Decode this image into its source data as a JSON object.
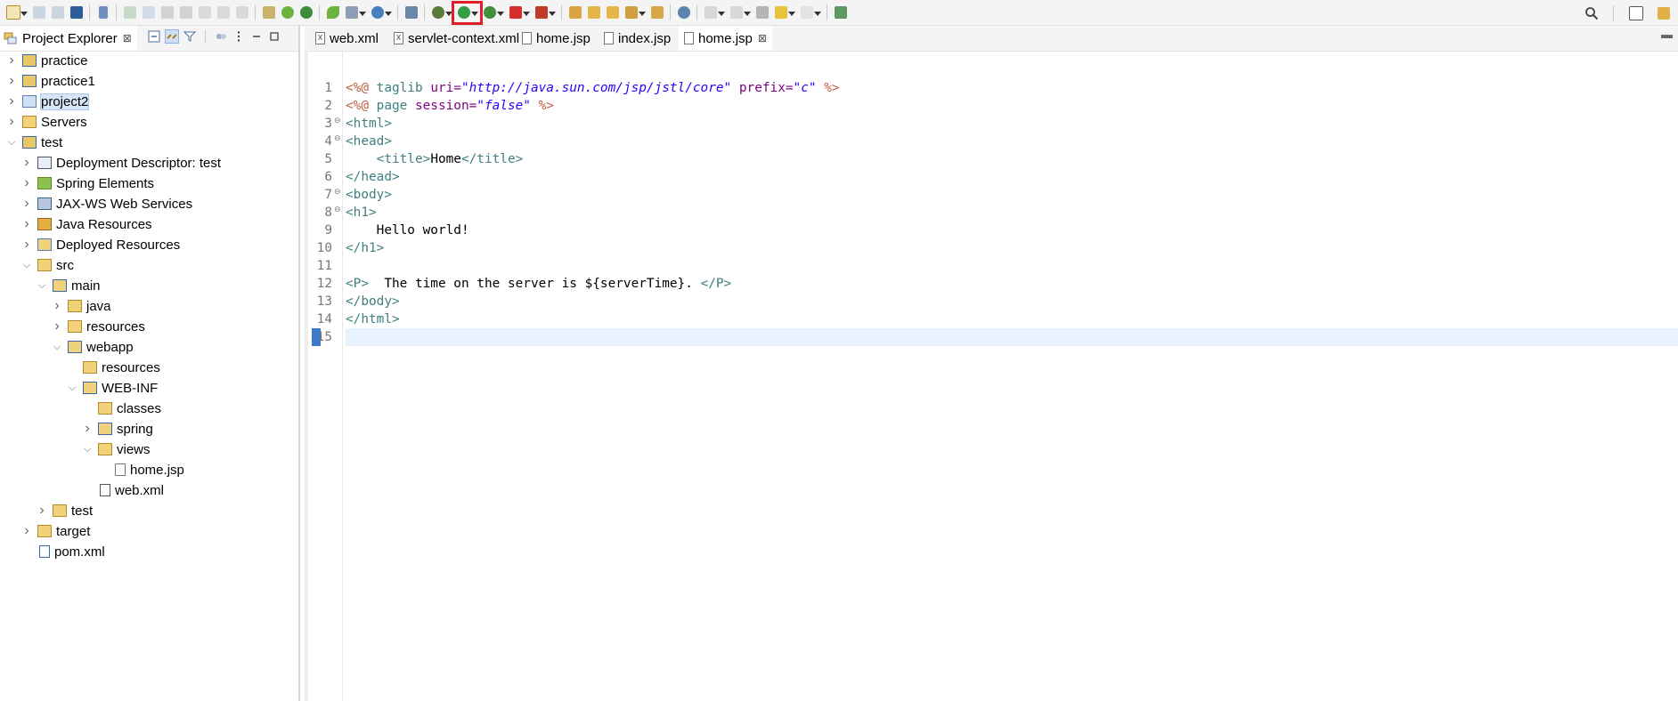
{
  "toolbar": {
    "run_button_highlight_color": "#e21f26"
  },
  "explorer": {
    "title": "Project Explorer",
    "close_glyph": "⊠",
    "tree": [
      {
        "label": "practice",
        "icon": "maven-project-icon",
        "expanded": false
      },
      {
        "label": "practice1",
        "icon": "maven-project-icon",
        "expanded": false
      },
      {
        "label": "project2",
        "icon": "project-icon",
        "expanded": false,
        "selected": true
      },
      {
        "label": "Servers",
        "icon": "folder-icon",
        "expanded": false
      },
      {
        "label": "test",
        "icon": "maven-project-icon",
        "expanded": true
      },
      {
        "label": "Deployment Descriptor: test",
        "icon": "deployment-descriptor-icon",
        "expanded": false
      },
      {
        "label": "Spring Elements",
        "icon": "spring-leaf-icon",
        "expanded": false
      },
      {
        "label": "JAX-WS Web Services",
        "icon": "web-services-icon",
        "expanded": false
      },
      {
        "label": "Java Resources",
        "icon": "java-resources-icon",
        "expanded": false
      },
      {
        "label": "Deployed Resources",
        "icon": "deployed-resources-icon",
        "expanded": false
      },
      {
        "label": "src",
        "icon": "folder-icon",
        "expanded": true
      },
      {
        "label": "main",
        "icon": "source-folder-icon",
        "expanded": true
      },
      {
        "label": "java",
        "icon": "folder-icon",
        "expanded": false
      },
      {
        "label": "resources",
        "icon": "folder-icon",
        "expanded": false
      },
      {
        "label": "webapp",
        "icon": "source-folder-icon",
        "expanded": true
      },
      {
        "label": "resources",
        "icon": "folder-icon",
        "expanded": null
      },
      {
        "label": "WEB-INF",
        "icon": "source-folder-icon",
        "expanded": true
      },
      {
        "label": "classes",
        "icon": "folder-icon",
        "expanded": null
      },
      {
        "label": "spring",
        "icon": "source-folder-icon",
        "expanded": false
      },
      {
        "label": "views",
        "icon": "folder-icon",
        "expanded": true
      },
      {
        "label": "home.jsp",
        "icon": "jsp-file-icon",
        "expanded": null
      },
      {
        "label": "web.xml",
        "icon": "xml-file-icon",
        "expanded": null
      },
      {
        "label": "test",
        "icon": "folder-icon",
        "expanded": false
      },
      {
        "label": "target",
        "icon": "folder-icon",
        "expanded": false
      },
      {
        "label": "pom.xml",
        "icon": "maven-pom-icon",
        "expanded": null
      }
    ]
  },
  "editor": {
    "tabs": [
      {
        "label": "web.xml",
        "icon": "xml-file-icon",
        "active": false
      },
      {
        "label": "servlet-context.xml",
        "icon": "xml-file-icon",
        "active": false
      },
      {
        "label": "home.jsp",
        "icon": "jsp-file-icon",
        "active": false
      },
      {
        "label": "index.jsp",
        "icon": "jsp-file-icon",
        "active": false
      },
      {
        "label": "home.jsp",
        "icon": "jsp-file-icon",
        "active": true
      }
    ],
    "close_glyph": "⊠",
    "current_line": 15,
    "lines": [
      {
        "n": "1",
        "fold": "",
        "tokens": [
          [
            "d",
            "<%@ "
          ],
          [
            "t",
            "taglib "
          ],
          [
            "a",
            "uri="
          ],
          [
            "v",
            "\"http://java.sun.com/jsp/jstl/core\""
          ],
          [
            "a",
            " prefix="
          ],
          [
            "v",
            "\"c\""
          ],
          [
            "d",
            " %>"
          ]
        ]
      },
      {
        "n": "2",
        "fold": "",
        "tokens": [
          [
            "d",
            "<%@ "
          ],
          [
            "t",
            "page "
          ],
          [
            "a",
            "session="
          ],
          [
            "v",
            "\"false\""
          ],
          [
            "d",
            " %>"
          ]
        ]
      },
      {
        "n": "3",
        "fold": "⊖",
        "tokens": [
          [
            "t",
            "<html>"
          ]
        ]
      },
      {
        "n": "4",
        "fold": "⊖",
        "tokens": [
          [
            "t",
            "<head>"
          ]
        ]
      },
      {
        "n": "5",
        "fold": "",
        "tokens": [
          [
            "x",
            "    "
          ],
          [
            "t",
            "<title>"
          ],
          [
            "x",
            "Home"
          ],
          [
            "t",
            "</title>"
          ]
        ]
      },
      {
        "n": "6",
        "fold": "",
        "tokens": [
          [
            "t",
            "</head>"
          ]
        ]
      },
      {
        "n": "7",
        "fold": "⊖",
        "tokens": [
          [
            "t",
            "<body>"
          ]
        ]
      },
      {
        "n": "8",
        "fold": "⊖",
        "tokens": [
          [
            "t",
            "<h1>"
          ]
        ]
      },
      {
        "n": "9",
        "fold": "",
        "tokens": [
          [
            "x",
            "    Hello world!"
          ]
        ]
      },
      {
        "n": "10",
        "fold": "",
        "tokens": [
          [
            "t",
            "</h1>"
          ]
        ]
      },
      {
        "n": "11",
        "fold": "",
        "tokens": []
      },
      {
        "n": "12",
        "fold": "",
        "tokens": [
          [
            "t",
            "<P>"
          ],
          [
            "x",
            "  The time on the server is ${serverTime}. "
          ],
          [
            "t",
            "</P>"
          ]
        ]
      },
      {
        "n": "13",
        "fold": "",
        "tokens": [
          [
            "t",
            "</body>"
          ]
        ]
      },
      {
        "n": "14",
        "fold": "",
        "tokens": [
          [
            "t",
            "</html>"
          ]
        ]
      },
      {
        "n": "15",
        "fold": "",
        "tokens": []
      }
    ]
  }
}
